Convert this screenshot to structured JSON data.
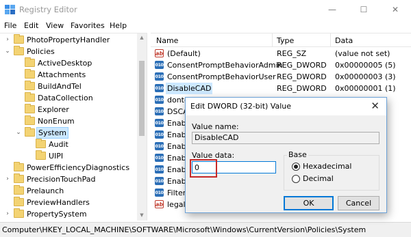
{
  "window": {
    "title": "Registry Editor",
    "minimize": "—",
    "maximize": "☐",
    "close": "✕"
  },
  "menu": [
    "File",
    "Edit",
    "View",
    "Favorites",
    "Help"
  ],
  "tree": {
    "items": [
      {
        "label": "PhotoPropertyHandler",
        "level": 1,
        "arrow": "›"
      },
      {
        "label": "Policies",
        "level": 1,
        "arrow": "⌄"
      },
      {
        "label": "ActiveDesktop",
        "level": 2,
        "arrow": ""
      },
      {
        "label": "Attachments",
        "level": 2,
        "arrow": ""
      },
      {
        "label": "BuildAndTel",
        "level": 2,
        "arrow": ""
      },
      {
        "label": "DataCollection",
        "level": 2,
        "arrow": ""
      },
      {
        "label": "Explorer",
        "level": 2,
        "arrow": ""
      },
      {
        "label": "NonEnum",
        "level": 2,
        "arrow": ""
      },
      {
        "label": "System",
        "level": 2,
        "arrow": "⌄",
        "selected": true
      },
      {
        "label": "Audit",
        "level": 3,
        "arrow": ""
      },
      {
        "label": "UIPI",
        "level": 3,
        "arrow": ""
      },
      {
        "label": "PowerEfficiencyDiagnostics",
        "level": 1,
        "arrow": ""
      },
      {
        "label": "PrecisionTouchPad",
        "level": 1,
        "arrow": "›"
      },
      {
        "label": "Prelaunch",
        "level": 1,
        "arrow": ""
      },
      {
        "label": "PreviewHandlers",
        "level": 1,
        "arrow": ""
      },
      {
        "label": "PropertySystem",
        "level": 1,
        "arrow": "›"
      }
    ]
  },
  "list": {
    "columns": [
      "Name",
      "Type",
      "Data"
    ],
    "rows": [
      {
        "icon": "ab",
        "name": "(Default)",
        "type": "REG_SZ",
        "data": "(value not set)"
      },
      {
        "icon": "dw",
        "name": "ConsentPromptBehaviorAdmin",
        "type": "REG_DWORD",
        "data": "0x00000005 (5)"
      },
      {
        "icon": "dw",
        "name": "ConsentPromptBehaviorUser",
        "type": "REG_DWORD",
        "data": "0x00000003 (3)"
      },
      {
        "icon": "dw",
        "name": "DisableCAD",
        "type": "REG_DWORD",
        "data": "0x00000001 (1)",
        "selected": true
      },
      {
        "icon": "dw",
        "name": "dontd",
        "type": "",
        "data": ""
      },
      {
        "icon": "dw",
        "name": "DSCAu",
        "type": "",
        "data": ""
      },
      {
        "icon": "dw",
        "name": "Enable",
        "type": "",
        "data": ""
      },
      {
        "icon": "dw",
        "name": "Enable",
        "type": "",
        "data": ""
      },
      {
        "icon": "dw",
        "name": "Enable",
        "type": "",
        "data": ""
      },
      {
        "icon": "dw",
        "name": "Enable",
        "type": "",
        "data": ""
      },
      {
        "icon": "dw",
        "name": "Enable",
        "type": "",
        "data": ""
      },
      {
        "icon": "dw",
        "name": "Enable",
        "type": "",
        "data": ""
      },
      {
        "icon": "dw",
        "name": "FilterA",
        "type": "",
        "data": ""
      },
      {
        "icon": "ab",
        "name": "legaln",
        "type": "",
        "data": ""
      }
    ]
  },
  "statusbar": {
    "path": "Computer\\HKEY_LOCAL_MACHINE\\SOFTWARE\\Microsoft\\Windows\\CurrentVersion\\Policies\\System"
  },
  "dialog": {
    "title": "Edit DWORD (32-bit) Value",
    "close": "✕",
    "value_name_label": "Value name:",
    "value_name": "DisableCAD",
    "value_data_label": "Value data:",
    "value_data": "0",
    "base_label": "Base",
    "hex_label": "Hexadecimal",
    "dec_label": "Decimal",
    "base_selected": "Hexadecimal",
    "ok": "OK",
    "cancel": "Cancel"
  },
  "colors": {
    "selection": "#cce8ff",
    "accent": "#0078d7",
    "highlight": "#c62828",
    "folder": "#f3d373"
  }
}
